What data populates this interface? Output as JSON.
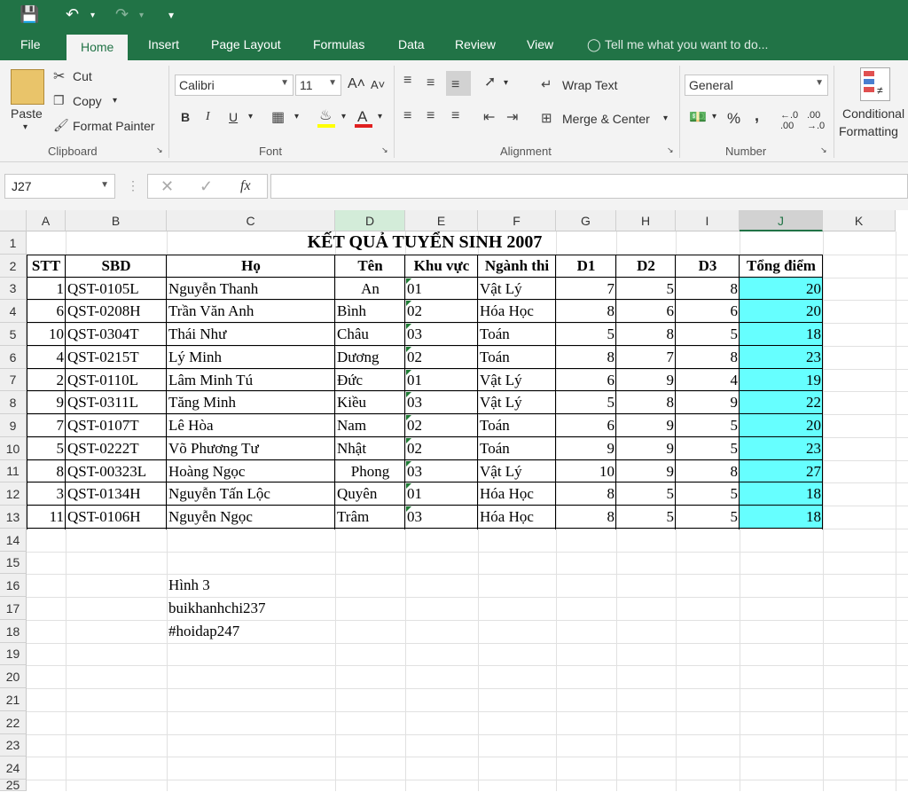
{
  "quick_access": {
    "save": "save-icon",
    "undo": "undo-icon",
    "redo": "redo-icon",
    "customize": "customize-icon"
  },
  "tabs": [
    "File",
    "Home",
    "Insert",
    "Page Layout",
    "Formulas",
    "Data",
    "Review",
    "View"
  ],
  "tell_me": "Tell me what you want to do...",
  "clipboard": {
    "paste": "Paste",
    "cut": "Cut",
    "copy": "Copy",
    "format_painter": "Format Painter",
    "label": "Clipboard"
  },
  "font": {
    "name": "Calibri",
    "size": "11",
    "label": "Font",
    "bold": "B",
    "italic": "I",
    "underline": "U"
  },
  "alignment": {
    "wrap": "Wrap Text",
    "merge": "Merge & Center",
    "label": "Alignment"
  },
  "number": {
    "format": "General",
    "percent": "%",
    "comma": ",",
    "inc_dec": ".0←.00",
    "dec_dec": ".00→.0",
    "label": "Number"
  },
  "styles": {
    "conditional_line1": "Conditional",
    "conditional_line2": "Formatting"
  },
  "formula_bar": {
    "name_box": "J27",
    "fx": "fx",
    "value": ""
  },
  "colors": {
    "excel_green": "#217346",
    "highlight": "#66ffff"
  },
  "columns": [
    "A",
    "B",
    "C",
    "D",
    "E",
    "F",
    "G",
    "H",
    "I",
    "J",
    "K"
  ],
  "rows": [
    "1",
    "2",
    "3",
    "4",
    "5",
    "6",
    "7",
    "8",
    "9",
    "10",
    "11",
    "12",
    "13",
    "14",
    "15",
    "16",
    "17",
    "18",
    "19",
    "20",
    "21",
    "22",
    "23",
    "24",
    "25"
  ],
  "sheet": {
    "title": "KẾT QUẢ TUYỂN SINH 2007",
    "headers": [
      "STT",
      "SBD",
      "Họ",
      "Tên",
      "Khu vực",
      "Ngành thi",
      "D1",
      "D2",
      "D3",
      "Tổng điểm"
    ],
    "records": [
      [
        "1",
        "QST-0105L",
        "Nguyễn Thanh",
        "An",
        "01",
        "Vật Lý",
        "7",
        "5",
        "8",
        "20"
      ],
      [
        "6",
        "QST-0208H",
        "Trần Văn Anh",
        "Bình",
        "02",
        "Hóa Học",
        "8",
        "6",
        "6",
        "20"
      ],
      [
        "10",
        "QST-0304T",
        "Thái Như",
        "Châu",
        "03",
        "Toán",
        "5",
        "8",
        "5",
        "18"
      ],
      [
        "4",
        "QST-0215T",
        "Lý Minh",
        "Dương",
        "02",
        "Toán",
        "8",
        "7",
        "8",
        "23"
      ],
      [
        "2",
        "QST-0110L",
        "Lâm Minh Tú",
        "Đức",
        "01",
        "Vật Lý",
        "6",
        "9",
        "4",
        "19"
      ],
      [
        "9",
        "QST-0311L",
        "Tăng Minh",
        "Kiều",
        "03",
        "Vật Lý",
        "5",
        "8",
        "9",
        "22"
      ],
      [
        "7",
        "QST-0107T",
        "Lê Hòa",
        "Nam",
        "02",
        "Toán",
        "6",
        "9",
        "5",
        "20"
      ],
      [
        "5",
        "QST-0222T",
        "Võ Phương Tư",
        "Nhật",
        "02",
        "Toán",
        "9",
        "9",
        "5",
        "23"
      ],
      [
        "8",
        "QST-00323L",
        "Hoàng Ngọc",
        "Phong",
        "03",
        "Vật Lý",
        "10",
        "9",
        "8",
        "27"
      ],
      [
        "3",
        "QST-0134H",
        "Nguyễn Tấn Lộc",
        "Quyên",
        "01",
        "Hóa Học",
        "8",
        "5",
        "5",
        "18"
      ],
      [
        "11",
        "QST-0106H",
        "Nguyễn Ngọc",
        "Trâm",
        "03",
        "Hóa Học",
        "8",
        "5",
        "5",
        "18"
      ]
    ],
    "notes": [
      "Hình 3",
      "buikhanhchi237",
      "#hoidap247"
    ]
  }
}
